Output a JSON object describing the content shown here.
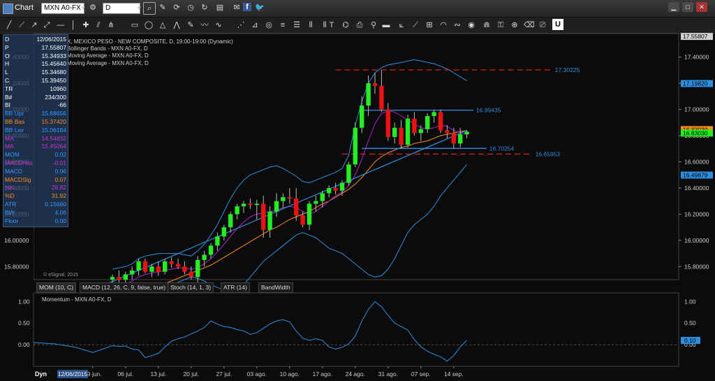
{
  "window": {
    "title": "Chart"
  },
  "toolbar": {
    "symbol": "MXN A0-FX",
    "interval": "D"
  },
  "legend": {
    "line1": "X, MEXICO PESO - NEW COMPOSITE, D, 19:00-19:00 (Dynamic)",
    "line2": "Bollinger Bands - MXN A0-FX, D",
    "line3": "Moving Average - MXN A0-FX, D",
    "line4": "Moving Average - MXN A0-FX, D",
    "watermark": "© eSignal, 2015"
  },
  "data_window": [
    {
      "k": "D",
      "v": "12/06/2015",
      "kc": "#ffffff",
      "vc": "#ffffff"
    },
    {
      "k": "P",
      "v": "17.55807",
      "kc": "#ffffff",
      "vc": "#ffffff"
    },
    {
      "k": "O",
      "v": "15.34933",
      "kc": "#ffffff",
      "vc": "#ffffff"
    },
    {
      "k": "H",
      "v": "15.45640",
      "kc": "#ffffff",
      "vc": "#ffffff"
    },
    {
      "k": "L",
      "v": "15.34680",
      "kc": "#ffffff",
      "vc": "#ffffff"
    },
    {
      "k": "C",
      "v": "15.39450",
      "kc": "#ffffff",
      "vc": "#ffffff"
    },
    {
      "k": "TR",
      "v": "10960",
      "kc": "#ffffff",
      "vc": "#ffffff"
    },
    {
      "k": "B#",
      "v": "234/300",
      "kc": "#ffffff",
      "vc": "#ffffff"
    },
    {
      "k": "BI",
      "v": "-66",
      "kc": "#ffffff",
      "vc": "#ffffff"
    },
    {
      "k": "BB Upr",
      "v": "15.68656",
      "kc": "#3399ff",
      "vc": "#3399ff"
    },
    {
      "k": "BB Bas",
      "v": "15.37420",
      "kc": "#ff8c1a",
      "vc": "#ff8c1a"
    },
    {
      "k": "BB Lwr",
      "v": "15.06184",
      "kc": "#3399ff",
      "vc": "#3399ff"
    },
    {
      "k": "MA",
      "v": "14.54832",
      "kc": "#cc33cc",
      "vc": "#cc33cc"
    },
    {
      "k": "MA",
      "v": "15.45064",
      "kc": "#cc33cc",
      "vc": "#cc33cc"
    },
    {
      "k": "MOM",
      "v": "0.02",
      "kc": "#3399ff",
      "vc": "#3399ff"
    },
    {
      "k": "MACDHist",
      "v": "-0.01",
      "kc": "#cc33cc",
      "vc": "#cc33cc"
    },
    {
      "k": "MACD",
      "v": "0.06",
      "kc": "#3399ff",
      "vc": "#3399ff"
    },
    {
      "k": "MACDSig",
      "v": "0.07",
      "kc": "#ff8c1a",
      "vc": "#ff8c1a"
    },
    {
      "k": "%K",
      "v": "28.82",
      "kc": "#cc33cc",
      "vc": "#cc33cc"
    },
    {
      "k": "%D",
      "v": "31.92",
      "kc": "#ff8c1a",
      "vc": "#ff8c1a"
    },
    {
      "k": "ATR",
      "v": "0.15660",
      "kc": "#3399ff",
      "vc": "#3399ff"
    },
    {
      "k": "BW",
      "v": "4.06",
      "kc": "#3399ff",
      "vc": "#3399ff"
    },
    {
      "k": "Floor",
      "v": "0.00",
      "kc": "#3399ff",
      "vc": "#3399ff"
    }
  ],
  "study_tabs": [
    "MOM (10, C)",
    "MACD (12, 26, C, 9, false, true)",
    "Stoch (14, 1, 3)",
    "ATR (14)",
    "BandWidth"
  ],
  "bottom": {
    "dyn": "Dyn",
    "date_box": "12/06/2015"
  },
  "colors": {
    "up": "#22ee22",
    "down": "#ee1111",
    "bb": "#2d8fe0",
    "ma_fast": "#aa22cc",
    "ma_slow": "#ff8c1a",
    "trend": "#2d8fe0",
    "resist": "#e02020",
    "bg": "#0b0b0b"
  },
  "chart_data": [
    {
      "type": "candlestick",
      "title": "X, MEXICO PESO - NEW COMPOSITE, D, 19:00-19:00 (Dynamic)",
      "ylim": [
        15.7,
        17.58
      ],
      "y_ticks": [
        "17.40000",
        "17.20000",
        "17.00000",
        "16.80000",
        "16.60000",
        "16.40000",
        "16.20000",
        "16.00000",
        "15.80000"
      ],
      "x_ticks": [
        "29 jun.",
        "06 jul.",
        "13 jul.",
        "20 jul.",
        "27 jul.",
        "03 ago.",
        "10 ago.",
        "17 ago.",
        "24 ago.",
        "31 ago.",
        "07 sep.",
        "14 sep."
      ],
      "candles": [
        {
          "o": 15.7,
          "h": 15.74,
          "l": 15.66,
          "c": 15.72
        },
        {
          "o": 15.72,
          "h": 15.77,
          "l": 15.68,
          "c": 15.7
        },
        {
          "o": 15.7,
          "h": 15.76,
          "l": 15.66,
          "c": 15.74
        },
        {
          "o": 15.74,
          "h": 15.8,
          "l": 15.7,
          "c": 15.77
        },
        {
          "o": 15.77,
          "h": 15.86,
          "l": 15.73,
          "c": 15.84
        },
        {
          "o": 15.84,
          "h": 15.86,
          "l": 15.75,
          "c": 15.76
        },
        {
          "o": 15.76,
          "h": 15.82,
          "l": 15.72,
          "c": 15.8
        },
        {
          "o": 15.8,
          "h": 15.84,
          "l": 15.73,
          "c": 15.76
        },
        {
          "o": 15.76,
          "h": 15.86,
          "l": 15.74,
          "c": 15.84
        },
        {
          "o": 15.84,
          "h": 15.87,
          "l": 15.79,
          "c": 15.82
        },
        {
          "o": 15.82,
          "h": 15.86,
          "l": 15.78,
          "c": 15.8
        },
        {
          "o": 15.8,
          "h": 15.84,
          "l": 15.74,
          "c": 15.76
        },
        {
          "o": 15.76,
          "h": 15.8,
          "l": 15.7,
          "c": 15.72
        },
        {
          "o": 15.72,
          "h": 15.88,
          "l": 15.68,
          "c": 15.85
        },
        {
          "o": 15.85,
          "h": 15.92,
          "l": 15.8,
          "c": 15.89
        },
        {
          "o": 15.89,
          "h": 15.98,
          "l": 15.86,
          "c": 15.96
        },
        {
          "o": 15.96,
          "h": 16.06,
          "l": 15.92,
          "c": 16.03
        },
        {
          "o": 16.03,
          "h": 16.12,
          "l": 16.0,
          "c": 16.1
        },
        {
          "o": 16.1,
          "h": 16.22,
          "l": 16.06,
          "c": 16.2
        },
        {
          "o": 16.2,
          "h": 16.28,
          "l": 16.16,
          "c": 16.26
        },
        {
          "o": 16.26,
          "h": 16.3,
          "l": 16.21,
          "c": 16.28
        },
        {
          "o": 16.28,
          "h": 16.32,
          "l": 16.24,
          "c": 16.27
        },
        {
          "o": 16.27,
          "h": 16.31,
          "l": 16.16,
          "c": 16.28
        },
        {
          "o": 16.28,
          "h": 16.34,
          "l": 16.02,
          "c": 16.08
        },
        {
          "o": 16.08,
          "h": 16.26,
          "l": 16.02,
          "c": 16.22
        },
        {
          "o": 16.22,
          "h": 16.36,
          "l": 16.18,
          "c": 16.3
        },
        {
          "o": 16.3,
          "h": 16.36,
          "l": 16.25,
          "c": 16.33
        },
        {
          "o": 16.33,
          "h": 16.4,
          "l": 16.28,
          "c": 16.32
        },
        {
          "o": 16.32,
          "h": 16.4,
          "l": 16.15,
          "c": 16.19
        },
        {
          "o": 16.19,
          "h": 16.22,
          "l": 16.1,
          "c": 16.12
        },
        {
          "o": 16.12,
          "h": 16.3,
          "l": 16.08,
          "c": 16.28
        },
        {
          "o": 16.28,
          "h": 16.34,
          "l": 16.22,
          "c": 16.3
        },
        {
          "o": 16.3,
          "h": 16.38,
          "l": 16.25,
          "c": 16.36
        },
        {
          "o": 16.36,
          "h": 16.42,
          "l": 16.33,
          "c": 16.4
        },
        {
          "o": 16.4,
          "h": 16.44,
          "l": 16.35,
          "c": 16.38
        },
        {
          "o": 16.38,
          "h": 16.46,
          "l": 16.34,
          "c": 16.44
        },
        {
          "o": 16.44,
          "h": 16.6,
          "l": 16.42,
          "c": 16.58
        },
        {
          "o": 16.58,
          "h": 16.9,
          "l": 16.56,
          "c": 16.86
        },
        {
          "o": 16.86,
          "h": 17.1,
          "l": 16.82,
          "c": 17.03
        },
        {
          "o": 17.03,
          "h": 17.26,
          "l": 16.95,
          "c": 17.2
        },
        {
          "o": 17.2,
          "h": 17.28,
          "l": 17.12,
          "c": 17.18
        },
        {
          "o": 17.18,
          "h": 17.3,
          "l": 16.98,
          "c": 17.0
        },
        {
          "o": 17.0,
          "h": 17.05,
          "l": 16.76,
          "c": 16.79
        },
        {
          "o": 16.79,
          "h": 16.9,
          "l": 16.74,
          "c": 16.86
        },
        {
          "o": 16.86,
          "h": 16.92,
          "l": 16.7,
          "c": 16.73
        },
        {
          "o": 16.73,
          "h": 16.96,
          "l": 16.71,
          "c": 16.93
        },
        {
          "o": 16.93,
          "h": 16.98,
          "l": 16.8,
          "c": 16.82
        },
        {
          "o": 16.82,
          "h": 16.88,
          "l": 16.76,
          "c": 16.85
        },
        {
          "o": 16.85,
          "h": 16.97,
          "l": 16.82,
          "c": 16.95
        },
        {
          "o": 16.95,
          "h": 17.0,
          "l": 16.9,
          "c": 16.98
        },
        {
          "o": 16.98,
          "h": 17.0,
          "l": 16.82,
          "c": 16.84
        },
        {
          "o": 16.84,
          "h": 16.88,
          "l": 16.78,
          "c": 16.82
        },
        {
          "o": 16.82,
          "h": 16.86,
          "l": 16.7,
          "c": 16.74
        },
        {
          "o": 16.74,
          "h": 16.86,
          "l": 16.71,
          "c": 16.81
        },
        {
          "o": 16.81,
          "h": 16.84,
          "l": 16.78,
          "c": 16.83
        }
      ],
      "ma_fast": [
        15.58,
        15.62,
        15.66,
        15.69,
        15.72,
        15.74,
        15.75,
        15.76,
        15.77,
        15.78,
        15.79,
        15.79,
        15.78,
        15.79,
        15.82,
        15.86,
        15.91,
        15.97,
        16.03,
        16.09,
        16.14,
        16.18,
        16.2,
        16.21,
        16.22,
        16.23,
        16.25,
        16.26,
        16.25,
        16.22,
        16.2,
        16.22,
        16.26,
        16.3,
        16.34,
        16.37,
        16.42,
        16.5,
        16.62,
        16.76,
        16.89,
        16.97,
        16.99,
        16.98,
        16.95,
        16.92,
        16.89,
        16.86,
        16.85,
        16.86,
        16.88,
        16.87,
        16.84,
        16.82,
        16.81
      ],
      "ma_slow": [
        15.5,
        15.52,
        15.54,
        15.57,
        15.59,
        15.61,
        15.63,
        15.65,
        15.67,
        15.69,
        15.71,
        15.73,
        15.75,
        15.77,
        15.79,
        15.81,
        15.84,
        15.87,
        15.9,
        15.93,
        15.96,
        15.99,
        16.02,
        16.05,
        16.08,
        16.1,
        16.13,
        16.16,
        16.18,
        16.2,
        16.22,
        16.25,
        16.28,
        16.3,
        16.33,
        16.36,
        16.39,
        16.43,
        16.48,
        16.54,
        16.6,
        16.64,
        16.67,
        16.69,
        16.71,
        16.72,
        16.74,
        16.75,
        16.76,
        16.78,
        16.8,
        16.81,
        16.82,
        16.83,
        16.84
      ],
      "bb_upper": [
        15.78,
        15.79,
        15.8,
        15.82,
        15.86,
        15.88,
        15.89,
        15.9,
        15.9,
        15.9,
        15.9,
        15.89,
        15.88,
        15.92,
        15.97,
        16.04,
        16.12,
        16.22,
        16.32,
        16.4,
        16.46,
        16.5,
        16.52,
        16.54,
        16.56,
        16.57,
        16.55,
        16.52,
        16.49,
        16.45,
        16.44,
        16.46,
        16.48,
        16.5,
        16.52,
        16.55,
        16.65,
        16.88,
        17.06,
        17.2,
        17.28,
        17.32,
        17.34,
        17.35,
        17.36,
        17.37,
        17.38,
        17.37,
        17.36,
        17.35,
        17.33,
        17.31,
        17.28,
        17.25,
        17.22
      ],
      "bb_lower": [
        15.6,
        15.61,
        15.62,
        15.62,
        15.6,
        15.6,
        15.61,
        15.62,
        15.64,
        15.66,
        15.68,
        15.7,
        15.72,
        15.71,
        15.69,
        15.66,
        15.64,
        15.62,
        15.6,
        15.62,
        15.66,
        15.72,
        15.78,
        15.84,
        15.88,
        15.92,
        15.96,
        16.0,
        16.04,
        16.06,
        16.04,
        16.02,
        15.98,
        15.94,
        15.92,
        15.9,
        15.86,
        15.82,
        15.78,
        15.74,
        15.72,
        15.73,
        15.78,
        15.86,
        15.96,
        16.06,
        16.12,
        16.16,
        16.2,
        16.26,
        16.34,
        16.4,
        16.46,
        16.52,
        16.58
      ],
      "trendline": [
        {
          "i": -4,
          "v": 15.6
        },
        {
          "i": 54,
          "v": 16.84
        }
      ],
      "levels": [
        {
          "value": 17.30225,
          "label": "17.30225",
          "color": "#e02020",
          "dash": true,
          "i0": 34,
          "i1": 67
        },
        {
          "value": 16.99435,
          "label": "16.99435",
          "color": "#2d8fe0",
          "dash": false,
          "i0": 38,
          "i1": 55
        },
        {
          "value": 16.70254,
          "label": "16.70254",
          "color": "#2d8fe0",
          "dash": false,
          "i0": 38,
          "i1": 57
        },
        {
          "value": 16.65953,
          "label": "16.65953",
          "color": "#e02020",
          "dash": true,
          "i0": 35,
          "i1": 64
        }
      ],
      "price_axis_tags": [
        {
          "value": 17.55807,
          "label": "17.55807",
          "bg": "#d0d0d0",
          "fg": "#000000"
        },
        {
          "value": 17.1982,
          "label": "17.19820",
          "bg": "#2d8fe0",
          "fg": "#000000"
        },
        {
          "value": 16.8303,
          "label": "16.83030",
          "bg": "#ff8c1a",
          "fg": "#000000"
        },
        {
          "value": 16.8303,
          "label": "16.83030",
          "bg": "#22ee22",
          "fg": "#000000"
        },
        {
          "value": 16.49879,
          "label": "16.49879",
          "bg": "#2d8fe0",
          "fg": "#000000"
        }
      ]
    },
    {
      "type": "line",
      "title": "Momentum - MXN A0-FX, D",
      "ylim": [
        -0.5,
        1.2
      ],
      "y_ticks": [
        1.0,
        0.5,
        0.0
      ],
      "current_label": "0.10",
      "series": [
        {
          "name": "Momentum - MXN A0-FX, D",
          "values": [
            -0.02,
            -0.04,
            -0.03,
            -0.1,
            -0.12,
            -0.3,
            -0.25,
            -0.2,
            -0.05,
            0.08,
            0.14,
            0.18,
            0.25,
            0.32,
            0.4,
            0.55,
            0.48,
            0.42,
            0.4,
            0.35,
            0.32,
            0.24,
            0.28,
            0.38,
            0.48,
            0.55,
            0.58,
            0.53,
            0.32,
            0.15,
            0.1,
            0.14,
            0.1,
            -0.05,
            -0.1,
            -0.06,
            0.02,
            0.2,
            0.55,
            0.82,
            1.0,
            0.88,
            0.68,
            0.5,
            0.42,
            0.34,
            0.12,
            -0.05,
            -0.15,
            -0.22,
            -0.28,
            -0.38,
            -0.25,
            -0.05,
            0.1
          ]
        }
      ]
    }
  ]
}
